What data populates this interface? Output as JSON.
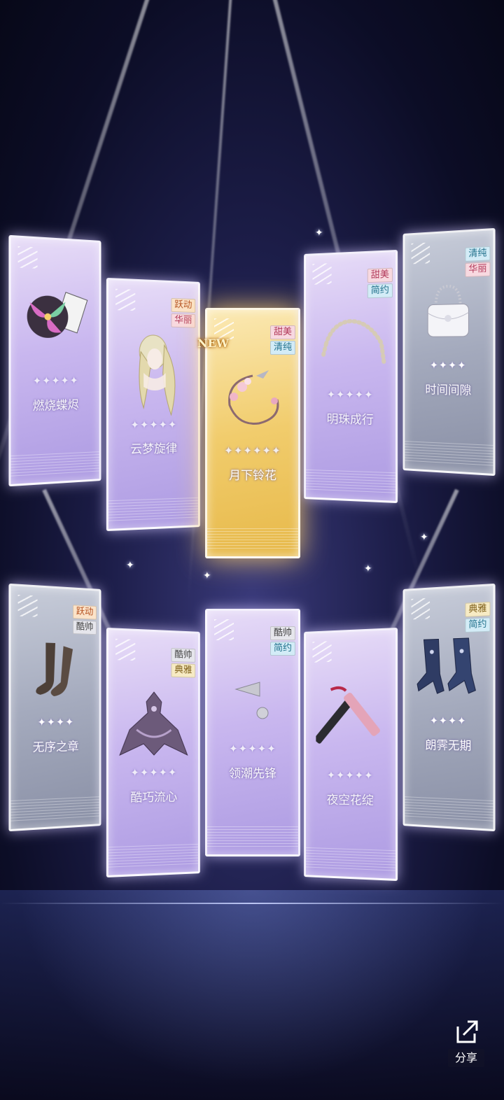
{
  "cards": [
    {
      "name": "燃烧蝶烬",
      "stars": "✦✦✦✦✦",
      "tags": [],
      "new": false,
      "theme": "purple"
    },
    {
      "name": "云梦旋律",
      "stars": "✦✦✦✦✦",
      "tags": [
        "跃动",
        "华丽"
      ],
      "new": false,
      "theme": "purple"
    },
    {
      "name": "月下铃花",
      "stars": "✦✦✦✦✦✦",
      "tags": [
        "甜美",
        "清纯"
      ],
      "new": true,
      "new_label": "NEW",
      "theme": "gold"
    },
    {
      "name": "明珠成行",
      "stars": "✦✦✦✦✦",
      "tags": [
        "甜美",
        "简约"
      ],
      "new": false,
      "theme": "purple"
    },
    {
      "name": "时间间隙",
      "stars": "✦✦✦✦",
      "tags": [
        "清纯",
        "华丽"
      ],
      "new": false,
      "theme": "grey"
    },
    {
      "name": "无序之章",
      "stars": "✦✦✦✦",
      "tags": [
        "跃动",
        "酷帅"
      ],
      "new": false,
      "theme": "grey"
    },
    {
      "name": "酷巧流心",
      "stars": "✦✦✦✦✦",
      "tags": [
        "酷帅",
        "典雅"
      ],
      "new": false,
      "theme": "purple"
    },
    {
      "name": "领潮先锋",
      "stars": "✦✦✦✦✦",
      "tags": [
        "酷帅",
        "简约"
      ],
      "new": false,
      "theme": "purple"
    },
    {
      "name": "夜空花绽",
      "stars": "✦✦✦✦✦",
      "tags": [],
      "new": false,
      "theme": "purple"
    },
    {
      "name": "朗霁无期",
      "stars": "✦✦✦✦",
      "tags": [
        "典雅",
        "简约"
      ],
      "new": false,
      "theme": "grey"
    }
  ],
  "share": {
    "label": "分享",
    "icon": "share-icon"
  }
}
